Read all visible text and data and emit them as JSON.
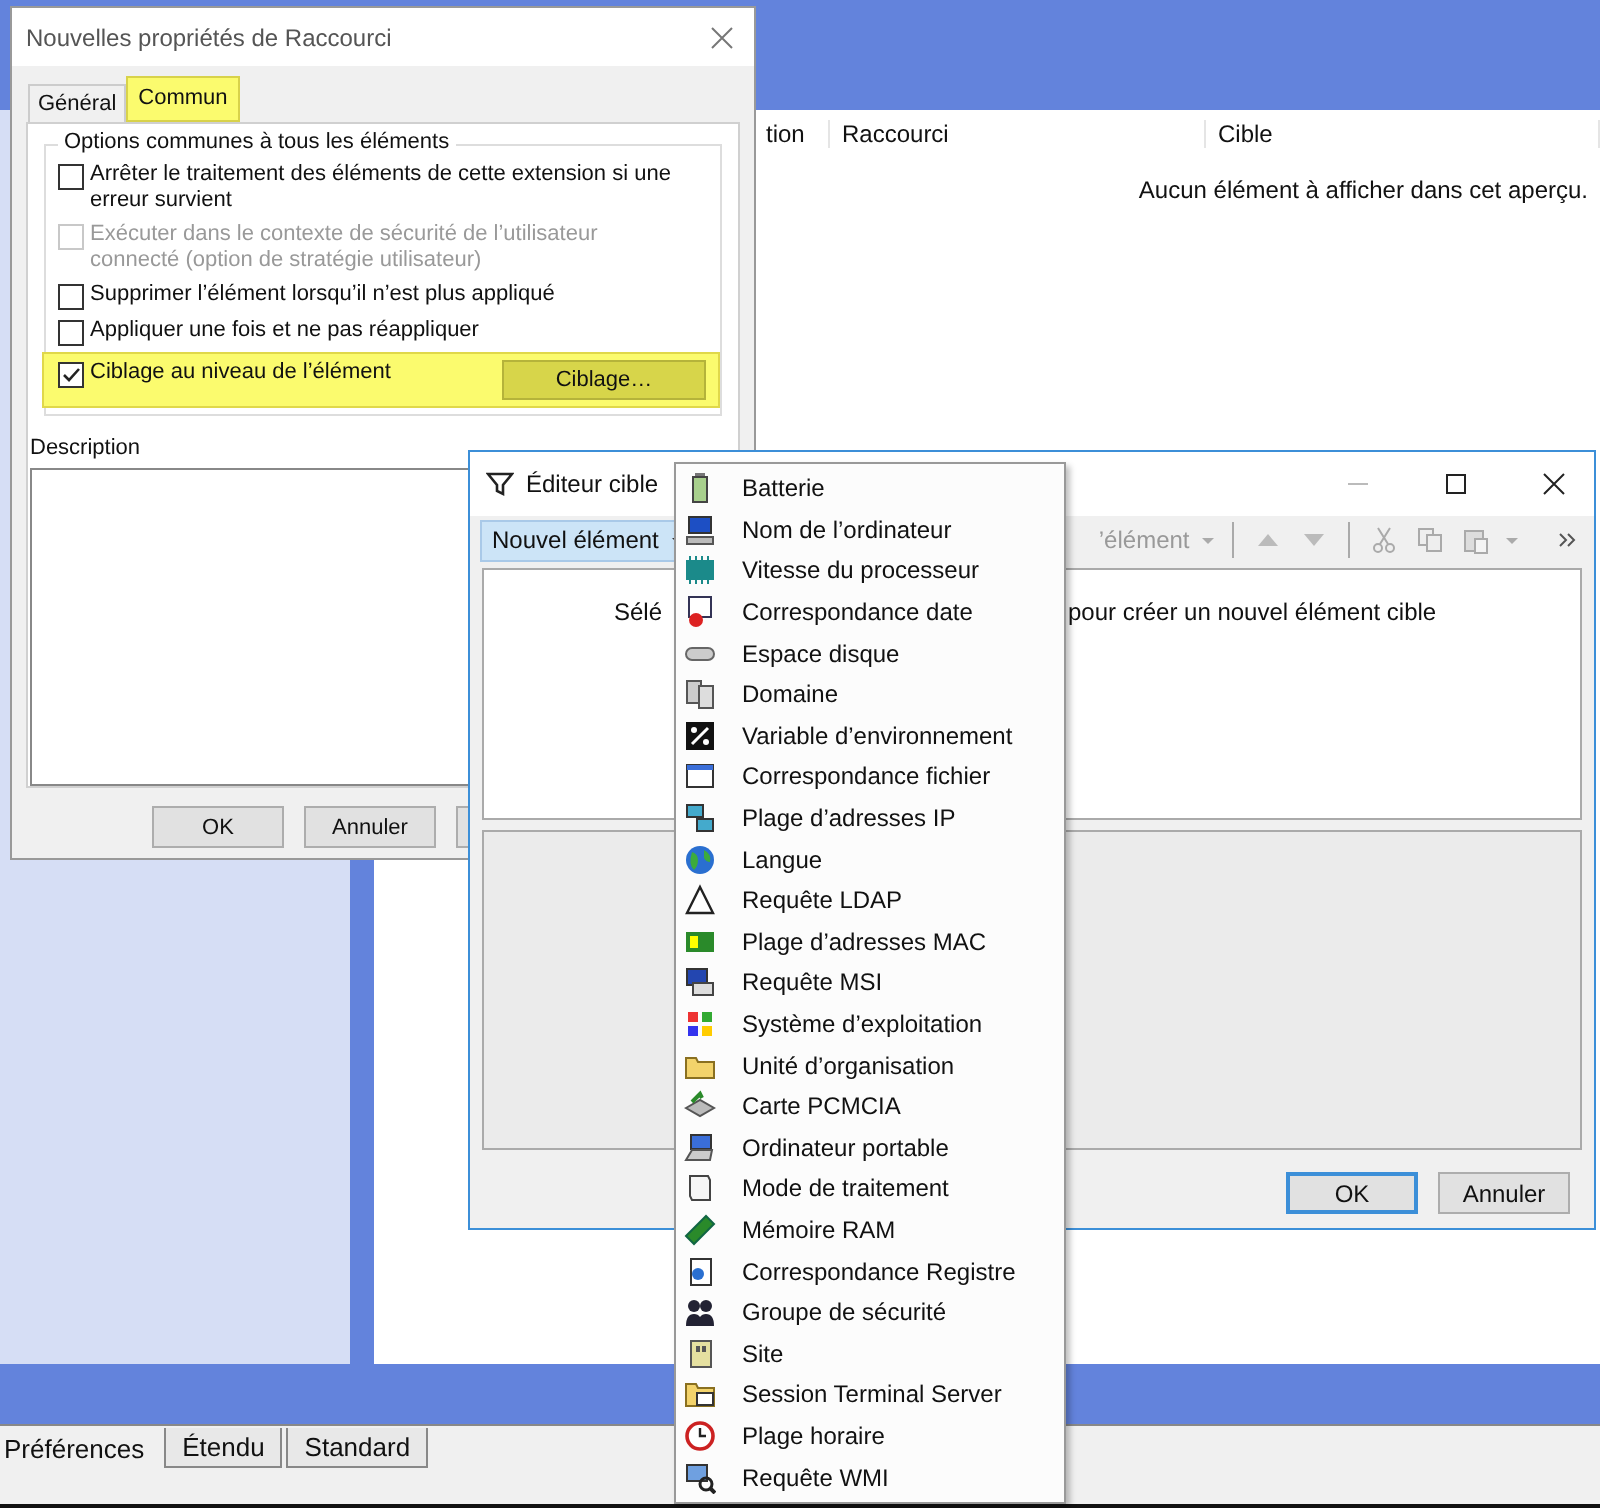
{
  "background_window": {
    "columns": [
      "tion",
      "Raccourci",
      "Cible"
    ],
    "empty_message": "Aucun élément à afficher dans cet aperçu.",
    "bottom_tabs": [
      {
        "label": "Préférences",
        "selected": true
      },
      {
        "label": "Étendu",
        "selected": false
      },
      {
        "label": "Standard",
        "selected": false
      }
    ]
  },
  "properties_dialog": {
    "title": "Nouvelles propriétés de Raccourci",
    "tabs": [
      {
        "label": "Général",
        "selected": false,
        "highlighted": false
      },
      {
        "label": "Commun",
        "selected": true,
        "highlighted": true
      }
    ],
    "group_title": "Options communes à tous les éléments",
    "options": [
      {
        "label": "Arrêter le traitement des éléments de cette extension si une erreur survient",
        "checked": false,
        "disabled": false,
        "highlighted": false
      },
      {
        "label": "Exécuter dans le contexte de sécurité de l’utilisateur connecté (option de stratégie utilisateur)",
        "checked": false,
        "disabled": true,
        "highlighted": false
      },
      {
        "label": "Supprimer l’élément lorsqu’il n’est plus appliqué",
        "checked": false,
        "disabled": false,
        "highlighted": false
      },
      {
        "label": "Appliquer une fois et ne pas réappliquer",
        "checked": false,
        "disabled": false,
        "highlighted": false
      },
      {
        "label": "Ciblage au niveau de l’élément",
        "checked": true,
        "disabled": false,
        "highlighted": true,
        "button": "Ciblage…"
      }
    ],
    "description_label": "Description",
    "buttons": [
      "OK",
      "Annuler"
    ]
  },
  "target_editor": {
    "title": "Éditeur cible",
    "new_item_button": "Nouvel élément",
    "toolbar_item": "’élément",
    "hint_start": "Sélé",
    "hint_end": "pour créer un nouvel élément cible",
    "buttons": [
      "OK",
      "Annuler"
    ]
  },
  "new_item_menu": [
    "Batterie",
    "Nom de l’ordinateur",
    "Vitesse du processeur",
    "Correspondance date",
    "Espace disque",
    "Domaine",
    "Variable d’environnement",
    "Correspondance fichier",
    "Plage d’adresses IP",
    "Langue",
    "Requête LDAP",
    "Plage d’adresses MAC",
    "Requête MSI",
    "Système d’exploitation",
    "Unité d’organisation",
    "Carte PCMCIA",
    "Ordinateur portable",
    "Mode de traitement",
    "Mémoire RAM",
    "Correspondance Registre",
    "Groupe de sécurité",
    "Site",
    "Session Terminal Server",
    "Plage horaire",
    "Requête WMI"
  ]
}
